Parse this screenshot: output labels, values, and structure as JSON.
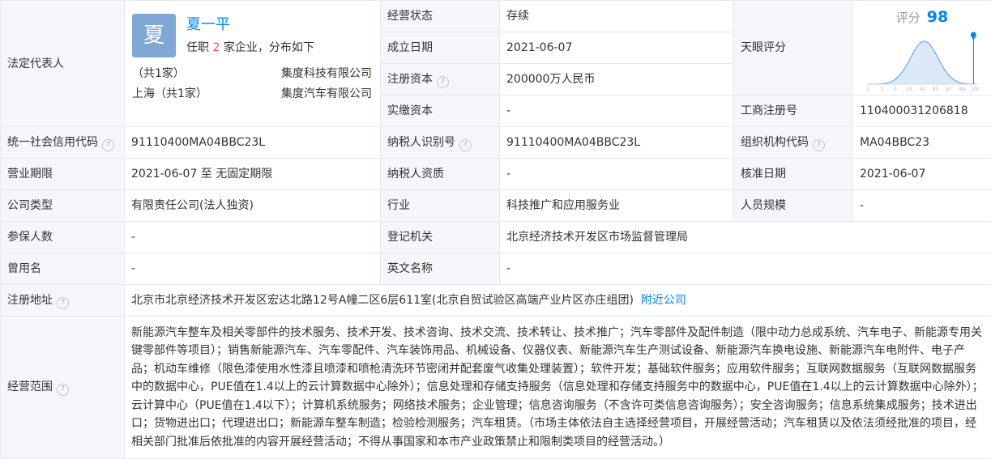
{
  "labels": {
    "legal_rep": "法定代表人",
    "status": "经营状态",
    "found_date": "成立日期",
    "reg_capital": "注册资本",
    "paid_capital": "实缴资本",
    "tianyan": "天眼评分",
    "reg_no": "工商注册号",
    "credit_code": "统一社会信用代码",
    "taxpayer_id": "纳税人识别号",
    "org_code": "组织机构代码",
    "term": "营业期限",
    "taxpayer_qual": "纳税人资质",
    "approval_date": "核准日期",
    "company_type": "公司类型",
    "industry": "行业",
    "staff_size": "人员规模",
    "insured": "参保人数",
    "reg_authority": "登记机关",
    "former_name": "曾用名",
    "english_name": "英文名称",
    "reg_address": "注册地址",
    "scope": "经营范围"
  },
  "legal_rep": {
    "avatar_char": "夏",
    "name": "夏一平",
    "summary_prefix": "任职",
    "summary_count": "2",
    "summary_suffix": "家企业，分布如下",
    "regions": [
      {
        "region": "（共1家）",
        "company": "集度科技有限公司"
      },
      {
        "region": "上海（共1家）",
        "company": "集度汽车有限公司"
      }
    ]
  },
  "values": {
    "status": "存续",
    "found_date": "2021-06-07",
    "reg_capital": "200000万人民币",
    "paid_capital": "-",
    "reg_no": "110400031206818",
    "credit_code": "91110400MA04BBC23L",
    "taxpayer_id": "91110400MA04BBC23L",
    "org_code": "MA04BBC23",
    "term": "2021-06-07 至 无固定期限",
    "taxpayer_qual": "-",
    "approval_date": "2021-06-07",
    "company_type": "有限责任公司(法人独资)",
    "industry": "科技推广和应用服务业",
    "staff_size": "-",
    "insured": "-",
    "reg_authority": "北京经济技术开发区市场监督管理局",
    "former_name": "-",
    "english_name": "-",
    "reg_address": "北京市北京经济技术开发区宏达北路12号A幢二区6层611室(北京自贸试验区高端产业片区亦庄组团)",
    "nearby_link": "附近公司",
    "scope": "新能源汽车整车及相关零部件的技术服务、技术开发、技术咨询、技术交流、技术转让、技术推广；汽车零部件及配件制造（限中动力总成系统、汽车电子、新能源专用关键零部件等项目）；销售新能源汽车、汽车零配件、汽车装饰用品、机械设备、仪器仪表、新能源汽车生产测试设备、新能源汽车换电设施、新能源汽车电附件、电子产品；机动车维修（限色漆使用水性漆且喷漆和喷枪清洗环节密闭并配套废气收集处理装置）；软件开发；基础软件服务；应用软件服务；互联网数据服务（互联网数据服务中的数据中心，PUE值在1.4以上的云计算数据中心除外）；信息处理和存储支持服务（信息处理和存储支持服务中的数据中心，PUE值在1.4以上的云计算数据中心除外）；云计算中心（PUE值在1.4以下）；计算机系统服务；网络技术服务；企业管理；信息咨询服务（不含许可类信息咨询服务）；安全咨询服务；信息系统集成服务；技术进出口；货物进出口；代理进出口；新能源车整车制造；检验检测服务；汽车租赁。（市场主体依法自主选择经营项目，开展经营活动；汽车租赁以及依法须经批准的项目，经相关部门批准后依批准的内容开展经营活动；不得从事国家和本市产业政策禁止和限制类项目的经营活动。）"
  },
  "score": {
    "label": "评分",
    "value": 98,
    "score_fraction": 0.98,
    "axis_ticks": [
      "0",
      "1",
      "3",
      "15",
      "50",
      "85",
      "97",
      "99",
      "100"
    ]
  },
  "colors": {
    "link": "#0084ff",
    "highlight": "#ff4d4f",
    "label_bg": "#f4f6f9",
    "border": "#e6e9ef",
    "avatar_bg": "#7fa9d4"
  },
  "icons": {
    "help": "question-circle-icon",
    "marker": "location-pin-icon"
  }
}
